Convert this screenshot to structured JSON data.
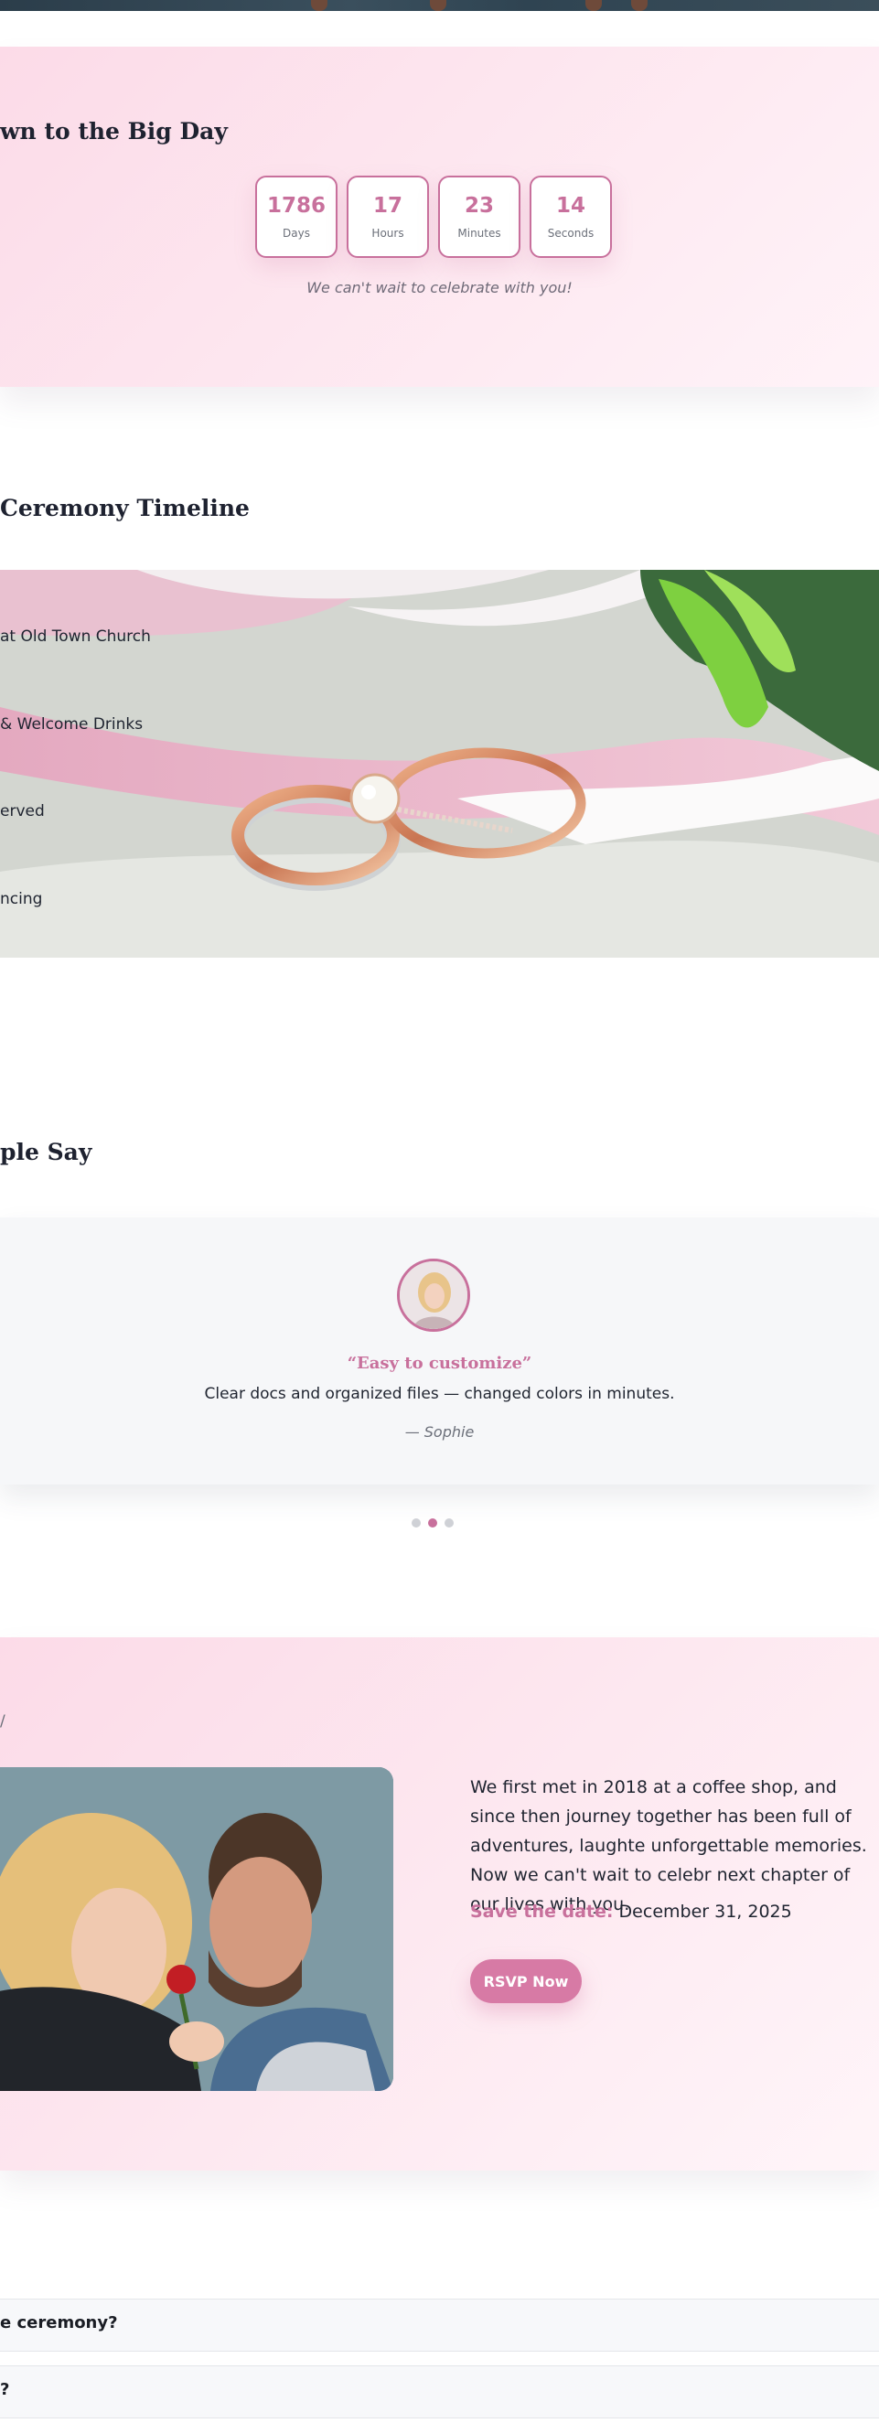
{
  "countdown": {
    "title": "wn to the Big Day",
    "units": [
      {
        "value": "1786",
        "label": "Days"
      },
      {
        "value": "17",
        "label": "Hours"
      },
      {
        "value": "23",
        "label": "Minutes"
      },
      {
        "value": "14",
        "label": "Seconds"
      }
    ],
    "tagline": "We can't wait to celebrate with you!"
  },
  "timeline": {
    "title": "Ceremony Timeline",
    "items": [
      "at Old Town Church",
      "& Welcome Drinks",
      "erved",
      "ncing"
    ]
  },
  "testimonials": {
    "title": "ple Say",
    "active": {
      "quote": "“Easy to customize”",
      "text": "Clear docs and organized files — changed colors in minutes.",
      "author": "— Sophie"
    },
    "dots": 3,
    "active_dot": 1
  },
  "story": {
    "kicker": "/",
    "paragraph": "We first met in 2018 at a coffee shop, and since then journey together has been full of adventures, laughte unforgettable memories. Now we can't wait to celebr next chapter of our lives with you.",
    "save_label": "Save the date:",
    "save_value": "December 31, 2025",
    "rsvp_label": "RSVP Now"
  },
  "faq": {
    "items": [
      {
        "question": "e ceremony?"
      },
      {
        "question": "?"
      }
    ]
  },
  "colors": {
    "accent": "#c8709c",
    "button": "#d77aa5",
    "section_bg": "#fde6ef"
  }
}
